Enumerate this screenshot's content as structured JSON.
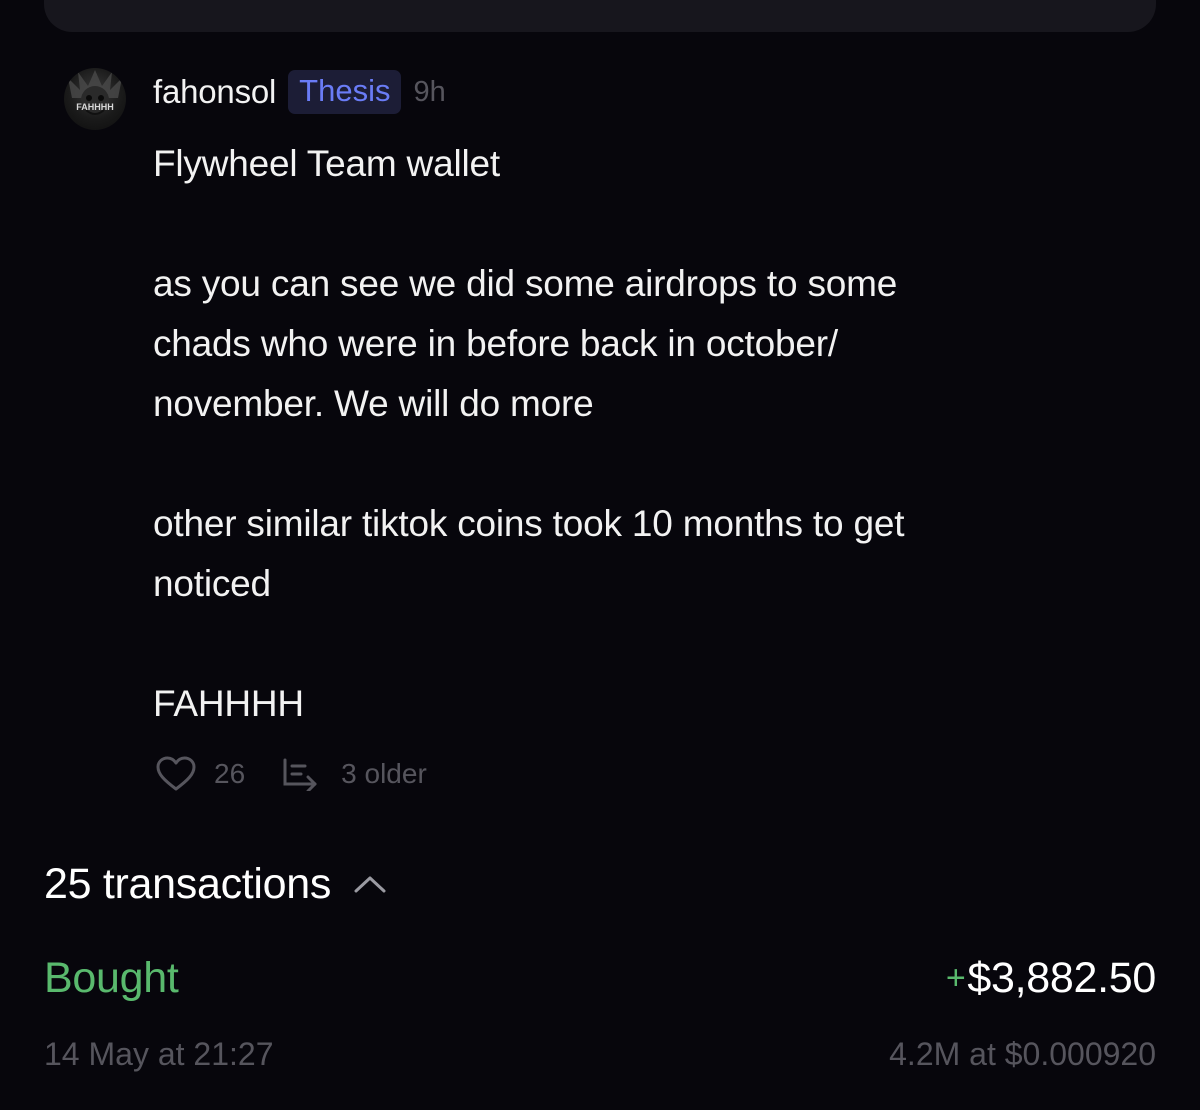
{
  "post": {
    "username": "fahonsol",
    "avatar_text": "FAHHHH",
    "badge": "Thesis",
    "time": "9h",
    "body": "Flywheel Team wallet\n\nas you can see we did some airdrops to some\nchads who were in before back in october/\nnovember. We will do more\n\nother similar tiktok coins took 10 months to get\nnoticed\n\nFAHHHH",
    "likes": "26",
    "older": "3 older",
    "icons": {
      "like": "heart-icon",
      "thread": "thread-reply-icon"
    }
  },
  "transactions": {
    "title": "25 transactions",
    "toggle_icon": "chevron-up-icon",
    "items": [
      {
        "type": "Bought",
        "amount_sign": "+",
        "amount": "$3,882.50",
        "date": "14 May at 21:27",
        "detail": "4.2M at $0.000920"
      }
    ]
  },
  "colors": {
    "background": "#07060c",
    "card": "#17161d",
    "badge_bg": "#1c1d36",
    "badge_text": "#6a7cf6",
    "muted": "#56555d",
    "positive": "#59b96d"
  }
}
